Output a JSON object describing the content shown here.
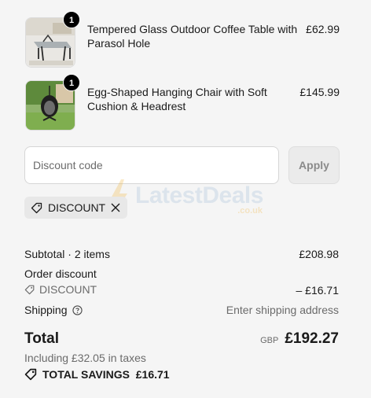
{
  "line_items": [
    {
      "title": "Tempered Glass Outdoor Coffee Table with Parasol Hole",
      "price": "£62.99",
      "quantity": "1",
      "image_icon": "glass-table-photo"
    },
    {
      "title": "Egg-Shaped Hanging Chair with Soft Cushion & Headrest",
      "price": "£145.99",
      "quantity": "1",
      "image_icon": "hanging-chair-photo"
    }
  ],
  "discount": {
    "placeholder": "Discount code",
    "apply_label": "Apply",
    "applied_code": "DISCOUNT"
  },
  "watermark": {
    "text": "LatestDeals",
    "sub": ".co.uk"
  },
  "summary": {
    "subtotal_label": "Subtotal · 2 items",
    "subtotal_value": "£208.98",
    "order_discount_label": "Order discount",
    "discount_code": "DISCOUNT",
    "discount_value": "– £16.71",
    "shipping_label": "Shipping",
    "shipping_value": "Enter shipping address",
    "total_label": "Total",
    "currency": "GBP",
    "total_value": "£192.27",
    "taxes_text": "Including £32.05 in taxes",
    "savings_text": "TOTAL SAVINGS  £16.71"
  },
  "colors": {
    "background": "#f5f5f5",
    "badge": "#000000",
    "muted_text": "#6b6b6b"
  }
}
